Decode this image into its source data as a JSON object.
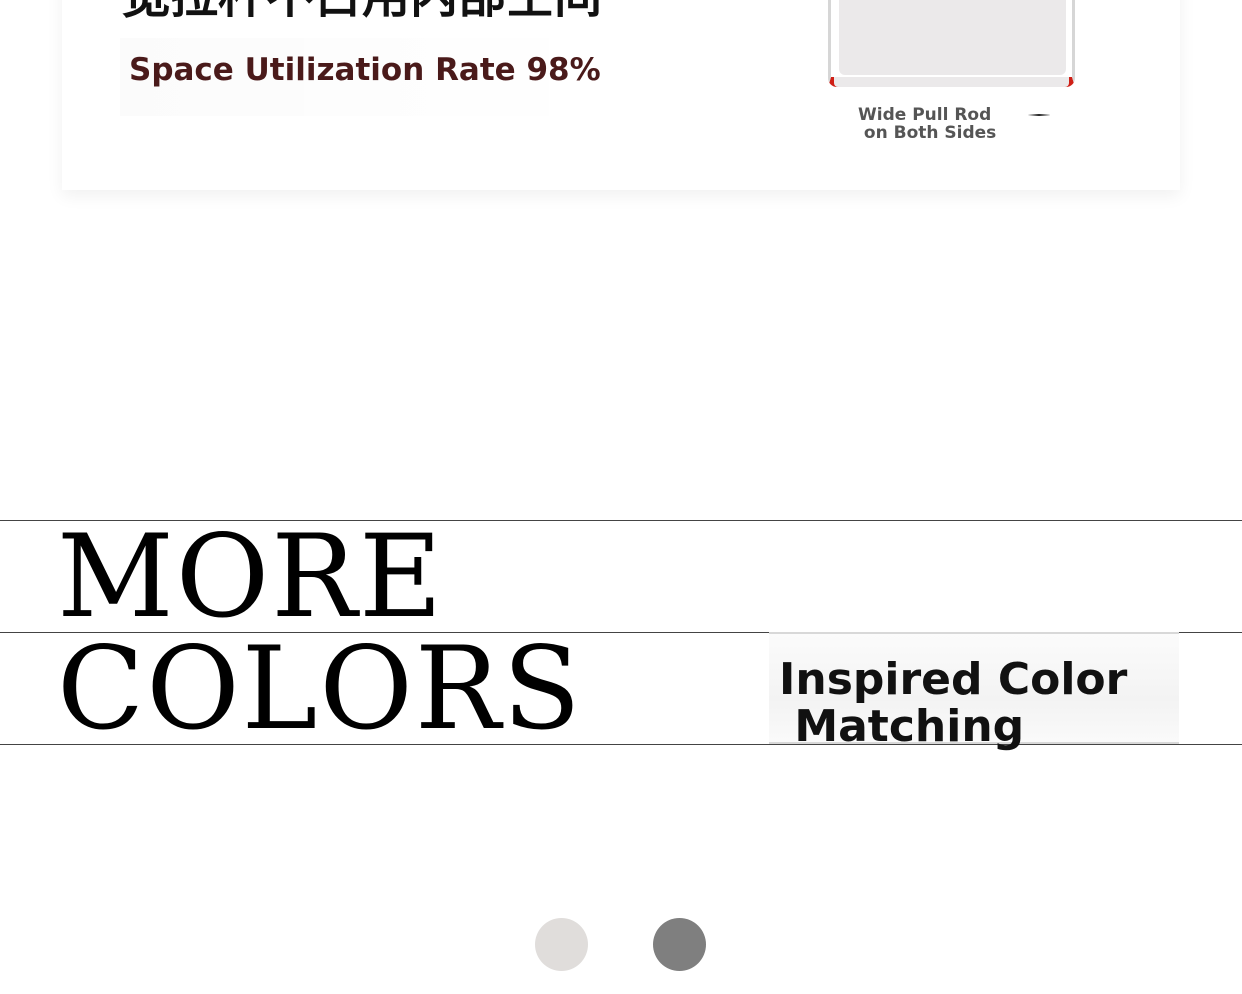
{
  "feature": {
    "headline_cn": "宽拉杆不占用内部空间",
    "space_rate_text": "Space Utilization Rate 98%"
  },
  "product": {
    "pull_rod_label": "Wide Pull Rod\n on Both Sides"
  },
  "colors_section": {
    "line1": "MORE",
    "line2": "COLORS",
    "tagline": "Inspired Color\n Matching"
  },
  "swatches": [
    {
      "color": "#e0dddb"
    },
    {
      "color": "#7f7f7f"
    }
  ],
  "accent_colors": {
    "frame_red": "#cf1f16",
    "rate_text": "#4a1a1a"
  }
}
